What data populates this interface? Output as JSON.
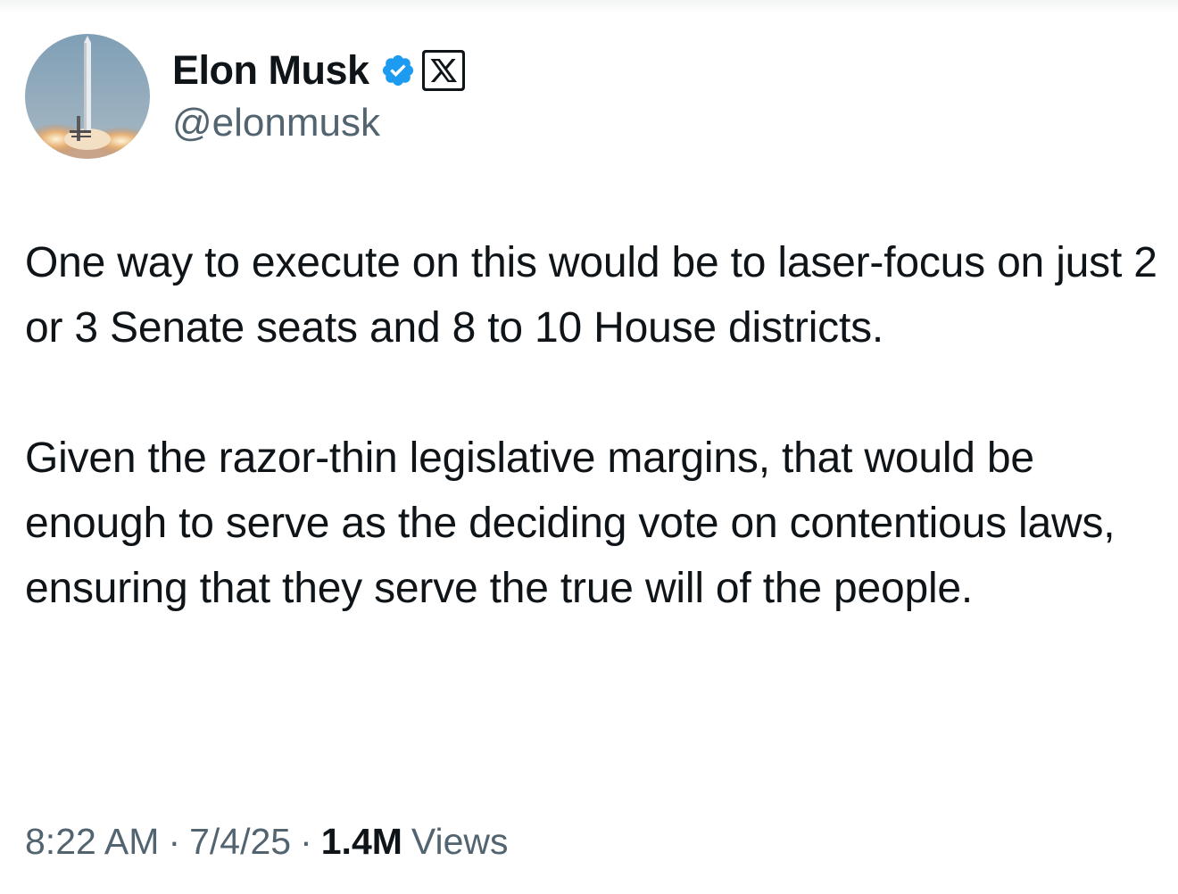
{
  "author": {
    "display_name": "Elon Musk",
    "handle": "@elonmusk",
    "verified": true,
    "verified_color": "#1d9bf0",
    "affiliation_badge": "x-logo-icon"
  },
  "tweet": {
    "paragraphs": [
      "One way to execute on this would be to laser-focus on just 2 or 3 Senate seats and 8 to 10 House districts.",
      "Given the razor-thin legislative margins, that would be enough to serve as the deciding vote on contentious laws, ensuring that they serve the true will of the people."
    ]
  },
  "meta": {
    "time": "8:22 AM",
    "separator": "·",
    "date": "7/4/25",
    "views_count": "1.4M",
    "views_label": "Views"
  },
  "colors": {
    "text_primary": "#0f1419",
    "text_secondary": "#536471",
    "background": "#ffffff"
  }
}
